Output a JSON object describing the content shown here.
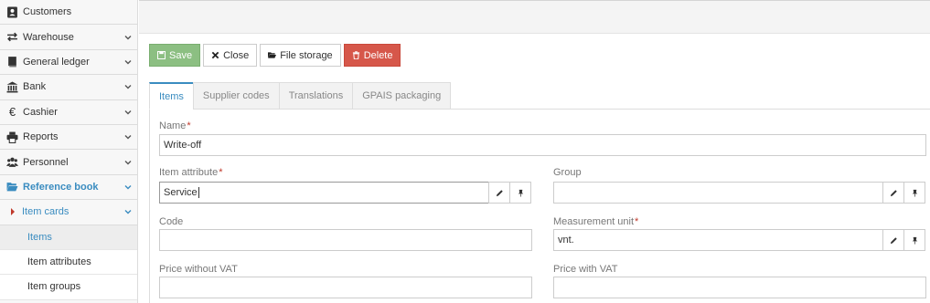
{
  "sidebar": {
    "items": [
      {
        "label": "Customers",
        "icon": "address-book-icon"
      },
      {
        "label": "Warehouse",
        "icon": "exchange-icon"
      },
      {
        "label": "General ledger",
        "icon": "book-icon"
      },
      {
        "label": "Bank",
        "icon": "bank-icon"
      },
      {
        "label": "Cashier",
        "icon": "euro-icon"
      },
      {
        "label": "Reports",
        "icon": "print-icon"
      },
      {
        "label": "Personnel",
        "icon": "users-icon"
      },
      {
        "label": "Reference book",
        "icon": "folder-open-icon"
      }
    ],
    "submenu_label": "Item cards",
    "leaves": [
      "Items",
      "Item attributes",
      "Item groups"
    ]
  },
  "toolbar": {
    "save_label": "Save",
    "close_label": "Close",
    "file_storage_label": "File storage",
    "delete_label": "Delete"
  },
  "tabs": [
    "Items",
    "Supplier codes",
    "Translations",
    "GPAIS packaging"
  ],
  "form": {
    "name_label": "Name",
    "name_value": "Write-off",
    "item_attribute_label": "Item attribute",
    "item_attribute_value": "Service",
    "group_label": "Group",
    "group_value": "",
    "code_label": "Code",
    "code_value": "",
    "measurement_unit_label": "Measurement unit",
    "measurement_unit_value": "vnt.",
    "price_without_vat_label": "Price without VAT",
    "price_without_vat_value": "",
    "price_with_vat_label": "Price with VAT",
    "price_with_vat_value": "",
    "required_mark": "*"
  },
  "colors": {
    "accent": "#3a8cc0",
    "save": "#8cbf82",
    "delete": "#d6574a",
    "required": "#c0392b"
  }
}
